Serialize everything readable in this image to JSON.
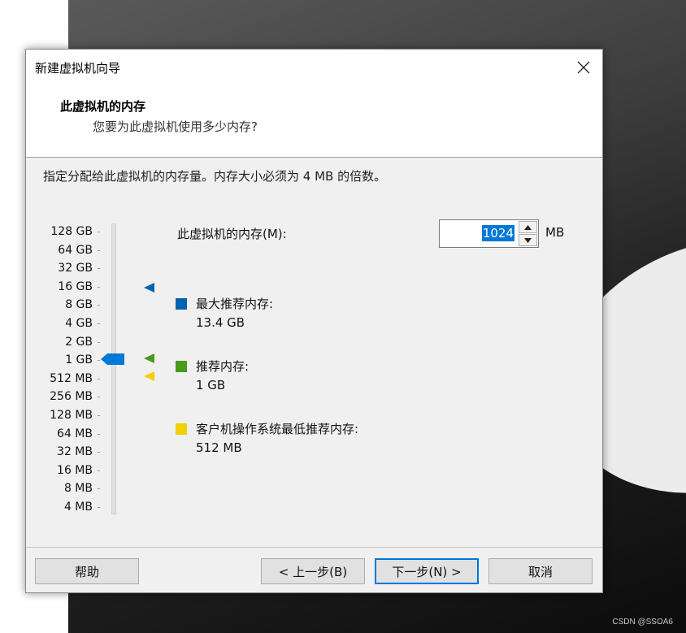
{
  "window": {
    "title": "新建虚拟机向导"
  },
  "header": {
    "title": "此虚拟机的内存",
    "subtitle": "您要为此虚拟机使用多少内存?"
  },
  "instruction": "指定分配给此虚拟机的内存量。内存大小必须为 4 MB 的倍数。",
  "scale": {
    "labels": [
      "128 GB",
      "64 GB",
      "32 GB",
      "16 GB",
      "8 GB",
      "4 GB",
      "2 GB",
      "1 GB",
      "512 MB",
      "256 MB",
      "128 MB",
      "64 MB",
      "32 MB",
      "16 MB",
      "8 MB",
      "4 MB"
    ],
    "selected": "1 GB"
  },
  "memory": {
    "label": "此虚拟机的内存(M):",
    "value": "1024",
    "unit": "MB"
  },
  "legend": {
    "max": {
      "title": "最大推荐内存:",
      "value": "13.4 GB",
      "color": "#0063b1"
    },
    "recommended": {
      "title": "推荐内存:",
      "value": "1 GB",
      "color": "#4a9a1a"
    },
    "min": {
      "title": "客户机操作系统最低推荐内存:",
      "value": "512 MB",
      "color": "#f0d000"
    }
  },
  "buttons": {
    "help": "帮助",
    "back": "< 上一步(B)",
    "next": "下一步(N) >",
    "cancel": "取消"
  },
  "watermark": "CSDN @SSOA6",
  "icons": {
    "close": "close-icon",
    "up": "arrow-up-icon",
    "down": "arrow-down-icon"
  }
}
